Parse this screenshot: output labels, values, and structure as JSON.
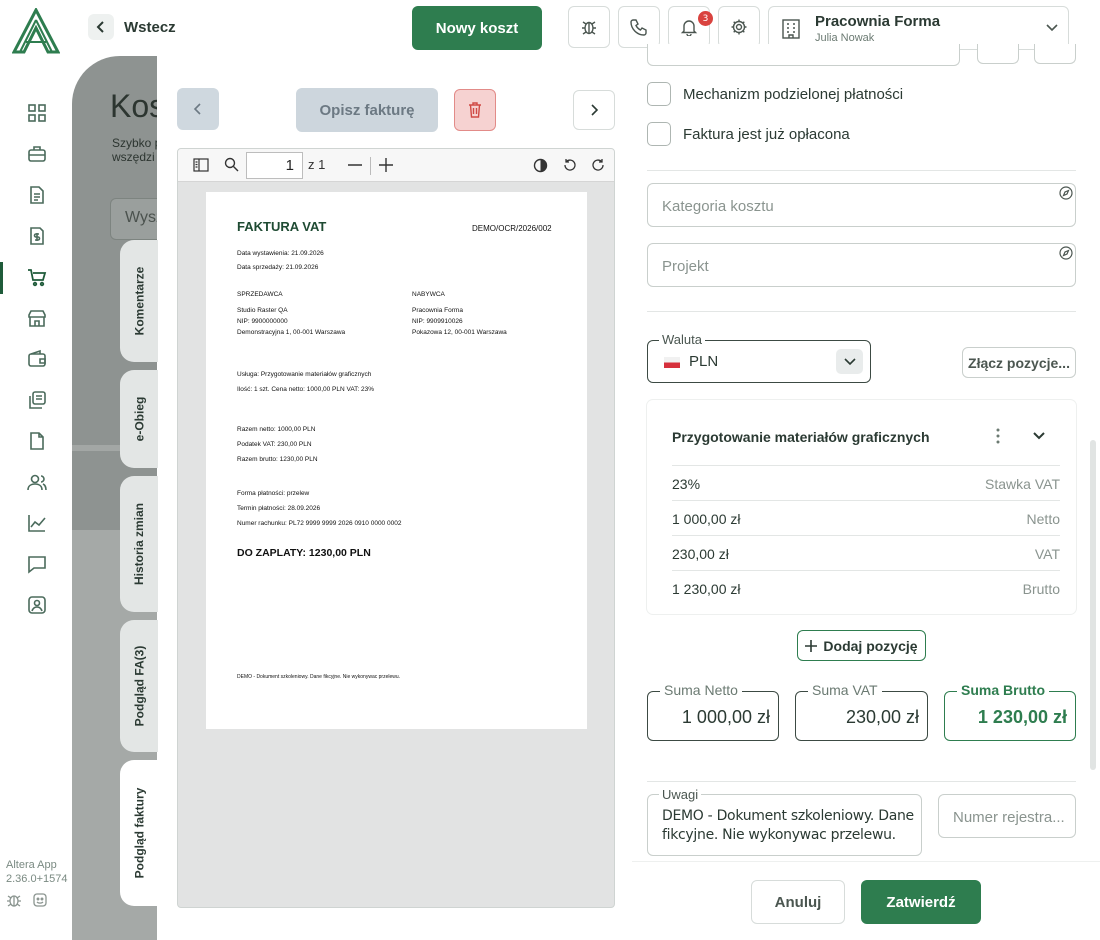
{
  "app": {
    "version_line1": "Altera App",
    "version_line2": "2.36.0+1574"
  },
  "topbar": {
    "back_label": "Wstecz",
    "new_cost_label": "Nowy koszt",
    "notifications_count": "3",
    "company_name": "Pracownia Forma",
    "user_name": "Julia Nowak"
  },
  "background_page": {
    "title": "Kos",
    "subtitle_line1": "Szybko p",
    "subtitle_line2": "wszędzi",
    "search_placeholder": "Wysz"
  },
  "side_tabs": [
    "Komentarze",
    "e-Obieg",
    "Historia zmian",
    "Podgląd FA(3)",
    "Podgląd faktury"
  ],
  "preview": {
    "describe_label": "Opisz fakturę",
    "page_current": "1",
    "page_of": "z 1",
    "invoice": {
      "title": "FAKTURA VAT",
      "number": "DEMO/OCR/2026/002",
      "issue_date": "Data wystawienia: 21.09.2026",
      "sale_date": "Data sprzedaży: 21.09.2026",
      "seller_header": "SPRZEDAWCA",
      "seller_name": "Studio Raster QA",
      "seller_nip": "NIP: 9900000000",
      "seller_address": "Demonstracyjna 1, 00-001 Warszawa",
      "buyer_header": "NABYWCA",
      "buyer_name": "Pracownia Forma",
      "buyer_nip": "NIP: 9909910026",
      "buyer_address": "Pokazowa 12, 00-001 Warszawa",
      "service": "Usługa: Przygotowanie materiałów graficznych",
      "quantity_line": "Ilość: 1 szt.    Cena netto: 1000,00 PLN    VAT: 23%",
      "total_net": "Razem netto: 1000,00 PLN",
      "total_vat": "Podatek VAT: 230,00 PLN",
      "total_gross": "Razem brutto: 1230,00 PLN",
      "payment_form": "Forma płatności: przelew",
      "payment_due": "Termin płatności: 28.09.2026",
      "account": "Numer rachunku: PL72 9999 9999 2026 0910 0000 0002",
      "to_pay": "DO ZAPLATY: 1230,00 PLN",
      "footer": "DEMO - Dokument szkoleniowy. Dane fikcyjne. Nie wykonywac przelewu."
    }
  },
  "form": {
    "split_payment_label": "Mechanizm podzielonej płatności",
    "already_paid_label": "Faktura jest już opłacona",
    "category_placeholder": "Kategoria kosztu",
    "project_placeholder": "Projekt",
    "currency_label": "Waluta",
    "currency_value": "PLN",
    "merge_label": "Złącz pozycje...",
    "line_item": {
      "name": "Przygotowanie materiałów graficznych",
      "rows": [
        {
          "value": "23%",
          "key": "Stawka VAT"
        },
        {
          "value": "1 000,00 zł",
          "key": "Netto"
        },
        {
          "value": "230,00 zł",
          "key": "VAT"
        },
        {
          "value": "1 230,00 zł",
          "key": "Brutto"
        }
      ]
    },
    "add_position_label": "Dodaj pozycję",
    "sum_net_label": "Suma Netto",
    "sum_net_value": "1 000,00 zł",
    "sum_vat_label": "Suma VAT",
    "sum_vat_value": "230,00 zł",
    "sum_gross_label": "Suma Brutto",
    "sum_gross_value": "1 230,00 zł",
    "notes_label": "Uwagi",
    "notes_value": "DEMO - Dokument szkoleniowy. Dane fikcyjne. Nie wykonywac przelewu.",
    "register_placeholder": "Numer rejestra..."
  },
  "actions": {
    "cancel_label": "Anuluj",
    "confirm_label": "Zatwierdź"
  },
  "colors": {
    "brand_green": "#2e7d4f",
    "danger_bg": "#f6d2d1",
    "badge": "#d9433f"
  },
  "icons": [
    "logo-icon",
    "dashboard-icon",
    "briefcase-icon",
    "document-icon",
    "invoice-dollar-icon",
    "cart-icon",
    "store-icon",
    "wallet-icon",
    "documents-icon",
    "file-icon",
    "users-icon",
    "chart-icon",
    "chat-icon",
    "contact-icon",
    "bug-icon",
    "phone-icon",
    "bell-icon",
    "gear-icon",
    "building-icon",
    "chevron-down-icon"
  ]
}
